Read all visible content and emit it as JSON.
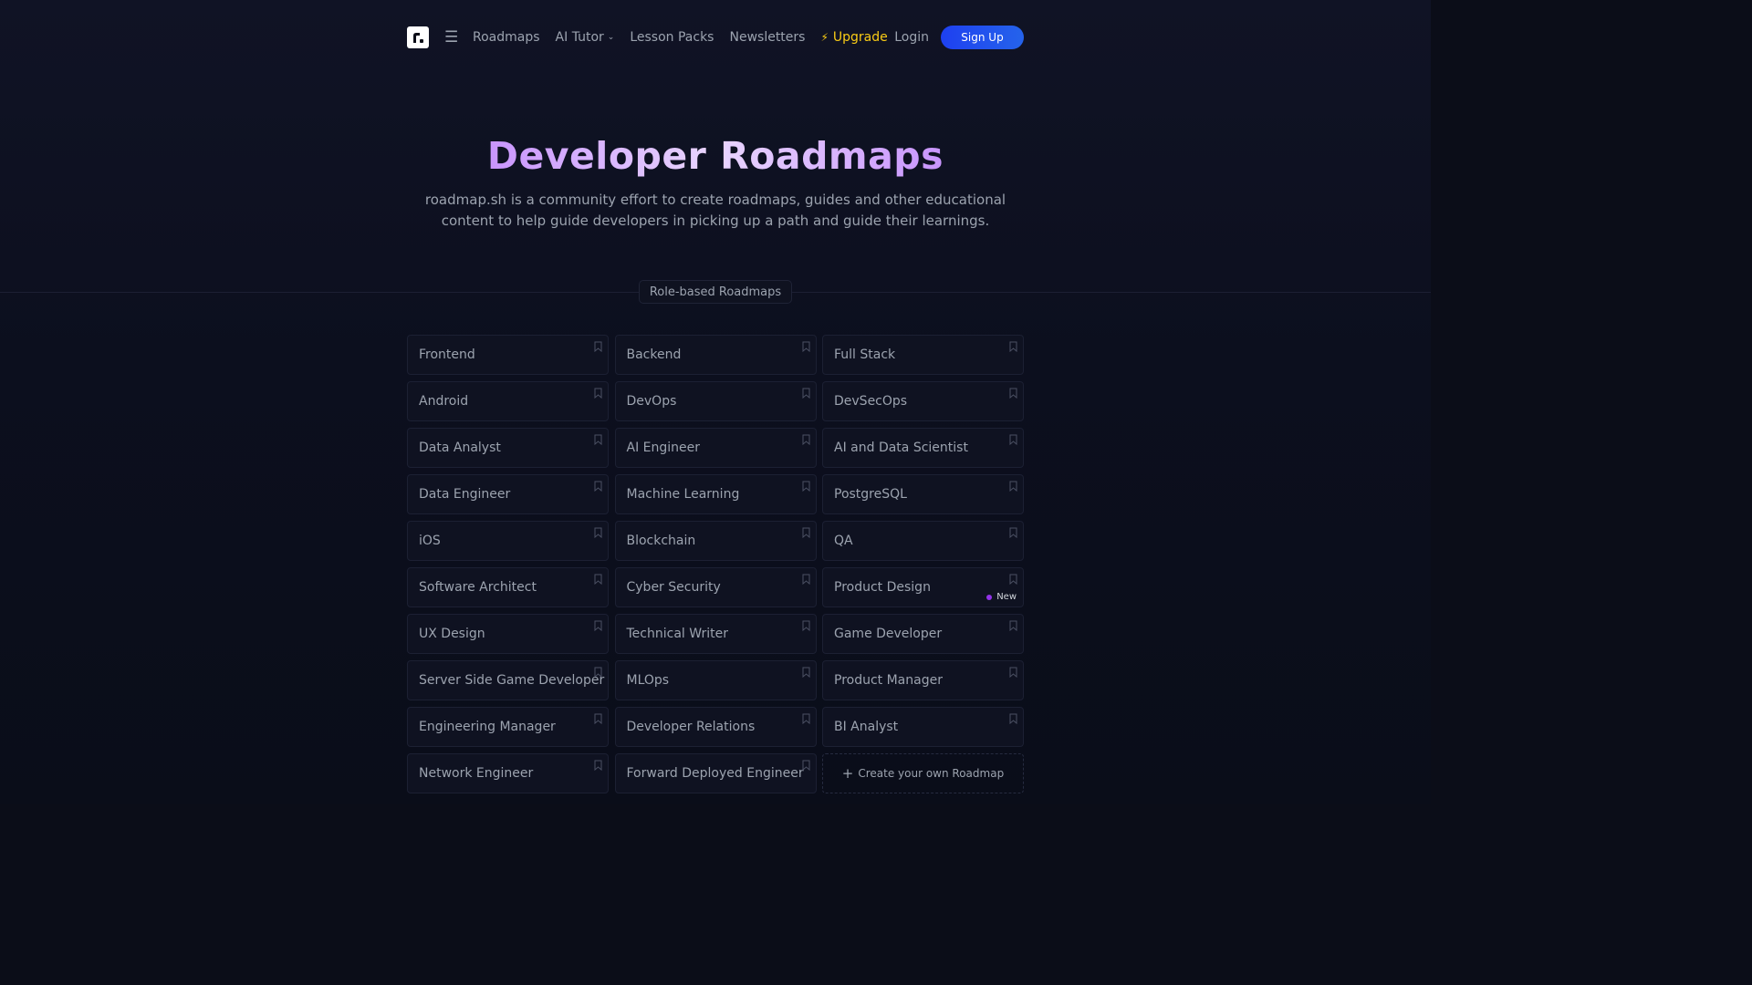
{
  "nav": {
    "logo_icon": "roadmap-logo-icon",
    "menu_icon": "hamburger-menu-icon",
    "links": [
      "Roadmaps",
      "AI Tutor",
      "Lesson Packs",
      "Newsletters"
    ],
    "upgrade": "Upgrade",
    "login": "Login",
    "signup": "Sign Up",
    "upgrade_color": "#facc15",
    "signup_color": "#1e40f0"
  },
  "hero": {
    "title": "Developer Roadmaps",
    "subtitle": "roadmap.sh is a community effort to create roadmaps, guides and other educational content to help guide developers in picking up a path and guide their learnings."
  },
  "section": {
    "label": "Role-based Roadmaps"
  },
  "roadmaps": [
    "Frontend",
    "Backend",
    "Full Stack",
    "Android",
    "DevOps",
    "DevSecOps",
    "Data Analyst",
    "AI Engineer",
    "AI and Data Scientist",
    "Data Engineer",
    "Machine Learning",
    "PostgreSQL",
    "iOS",
    "Blockchain",
    "QA",
    "Software Architect",
    "Cyber Security",
    "Product Design",
    "UX Design",
    "Technical Writer",
    "Game Developer",
    "Server Side Game Developer",
    "MLOps",
    "Product Manager",
    "Engineering Manager",
    "Developer Relations",
    "BI Analyst",
    "Network Engineer",
    "Forward Deployed Engineer"
  ],
  "new_badge": {
    "label": "New",
    "index": 17,
    "dot_color": "#9333ea"
  },
  "create": {
    "label": "Create your own Roadmap"
  }
}
